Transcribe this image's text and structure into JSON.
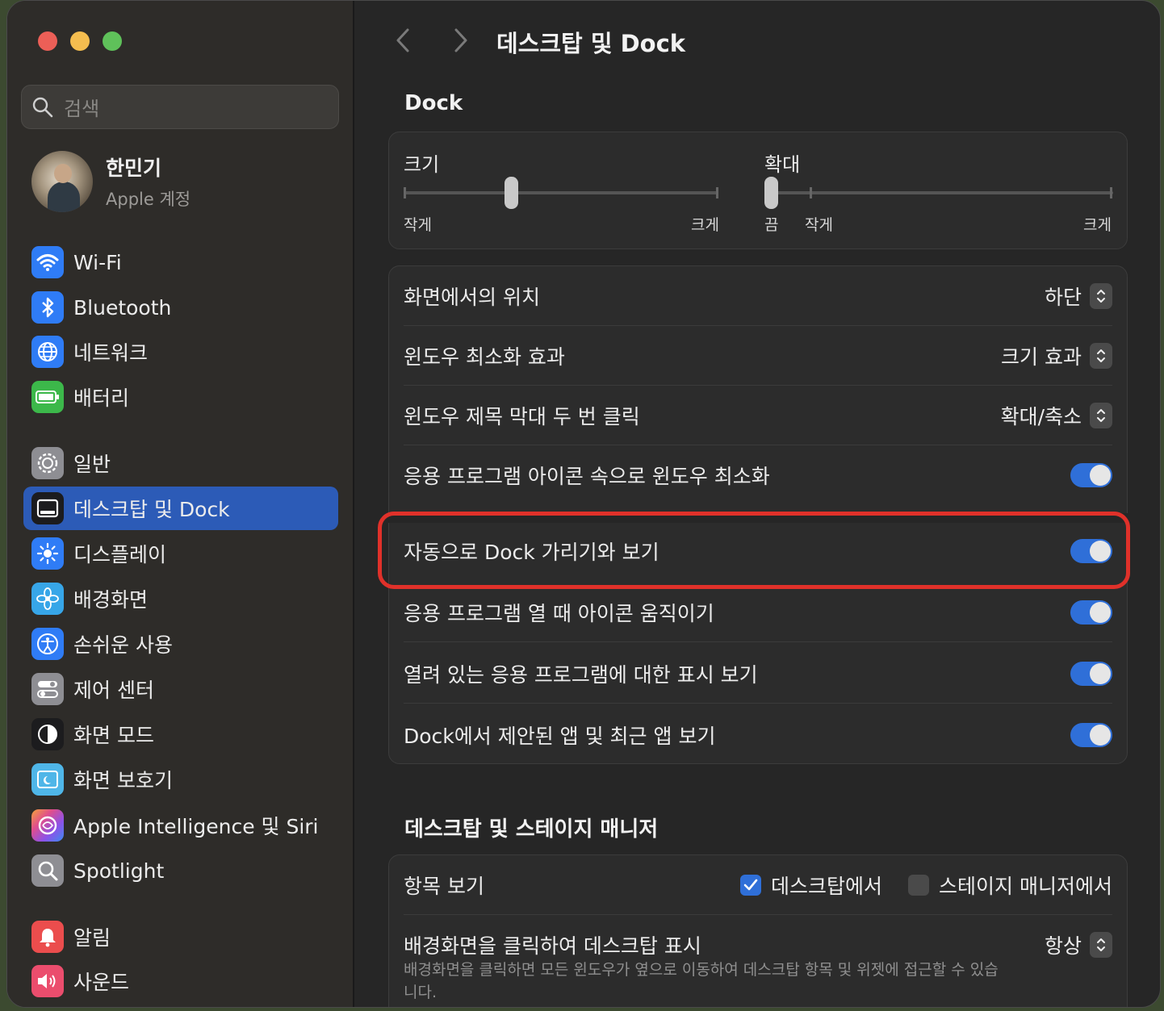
{
  "sidebar": {
    "search_placeholder": "검색",
    "profile": {
      "name": "한민기",
      "subtitle": "Apple 계정"
    },
    "items": [
      {
        "label": "Wi-Fi",
        "icon": "wifi-icon",
        "color": "#2f7cf6"
      },
      {
        "label": "Bluetooth",
        "icon": "bluetooth-icon",
        "color": "#2f7cf6"
      },
      {
        "label": "네트워크",
        "icon": "globe-icon",
        "color": "#2f7cf6"
      },
      {
        "label": "배터리",
        "icon": "battery-icon",
        "color": "#3cb84a"
      },
      {
        "label": "일반",
        "icon": "gear-icon",
        "color": "#8e8e93"
      },
      {
        "label": "데스크탑 및 Dock",
        "icon": "dock-icon",
        "color": "#1c1c1e",
        "active": true
      },
      {
        "label": "디스플레이",
        "icon": "sun-icon",
        "color": "#2f7cf6"
      },
      {
        "label": "배경화면",
        "icon": "flower-icon",
        "color": "#37a6e8"
      },
      {
        "label": "손쉬운 사용",
        "icon": "accessibility-icon",
        "color": "#2f7cf6"
      },
      {
        "label": "제어 센터",
        "icon": "switches-icon",
        "color": "#8e8e93"
      },
      {
        "label": "화면 모드",
        "icon": "appearance-icon",
        "color": "#1c1c1e"
      },
      {
        "label": "화면 보호기",
        "icon": "screensaver-icon",
        "color": "#4fb6e8"
      },
      {
        "label": "Apple Intelligence 및 Siri",
        "icon": "siri-icon",
        "color": "#c25be0"
      },
      {
        "label": "Spotlight",
        "icon": "magnifier-icon",
        "color": "#8e8e93"
      },
      {
        "label": "알림",
        "icon": "bell-icon",
        "color": "#eb4d4d"
      },
      {
        "label": "사운드",
        "icon": "speaker-icon",
        "color": "#eb4d6d"
      }
    ]
  },
  "main": {
    "title": "데스크탑 및 Dock",
    "dock_section": "Dock",
    "size": {
      "label": "크기",
      "min": "작게",
      "max": "크게",
      "value": 0.34
    },
    "magnify": {
      "label": "확대",
      "off": "끔",
      "min": "작게",
      "max": "크게",
      "value": 0.0
    },
    "popups": [
      {
        "label": "화면에서의 위치",
        "value": "하단"
      },
      {
        "label": "윈도우 최소화 효과",
        "value": "크기 효과"
      },
      {
        "label": "윈도우 제목 막대 두 번 클릭",
        "value": "확대/축소"
      }
    ],
    "toggles": [
      {
        "label": "응용 프로그램 아이콘 속으로 윈도우 최소화",
        "on": true
      },
      {
        "label": "자동으로 Dock 가리기와 보기",
        "on": true
      },
      {
        "label": "응용 프로그램 열 때 아이콘 움직이기",
        "on": true
      },
      {
        "label": "열려 있는 응용 프로그램에 대한 표시 보기",
        "on": true
      },
      {
        "label": "Dock에서 제안된 앱 및 최근 앱 보기",
        "on": true
      }
    ],
    "stage_section": "데스크탑 및 스테이지 매니저",
    "show_items": {
      "label": "항목 보기",
      "opt1": "데스크탑에서",
      "opt1_checked": true,
      "opt2": "스테이지 매니저에서",
      "opt2_checked": false
    },
    "click_wallpaper": {
      "label": "배경화면을 클릭하여 데스크탑 표시",
      "value": "항상",
      "desc": "배경화면을 클릭하면 모든 윈도우가 옆으로 이동하여 데스크탑 항목 및 위젯에 접근할 수 있습니다."
    }
  }
}
